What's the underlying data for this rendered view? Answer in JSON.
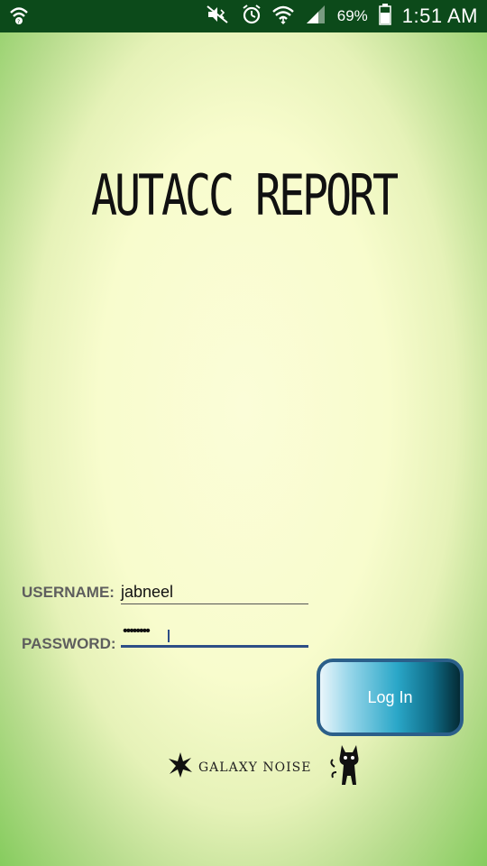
{
  "status_bar": {
    "battery_percent": "69%",
    "time": "1:51 AM",
    "icons": [
      "wifi-question-icon",
      "mute-icon",
      "alarm-icon",
      "wifi-icon",
      "signal-icon",
      "battery-icon"
    ]
  },
  "app": {
    "title": "AUTACC REPORT",
    "brand": "GALAXY NOISE"
  },
  "form": {
    "username_label": "USERNAME:",
    "username_value": "jabneel",
    "password_label": "PASSWORD:",
    "password_masked": "••••••••",
    "login_label": "Log In"
  },
  "colors": {
    "status_bar_bg": "#0c4a1a",
    "login_border": "#2b5f8a",
    "password_underline": "#2d4e86"
  }
}
